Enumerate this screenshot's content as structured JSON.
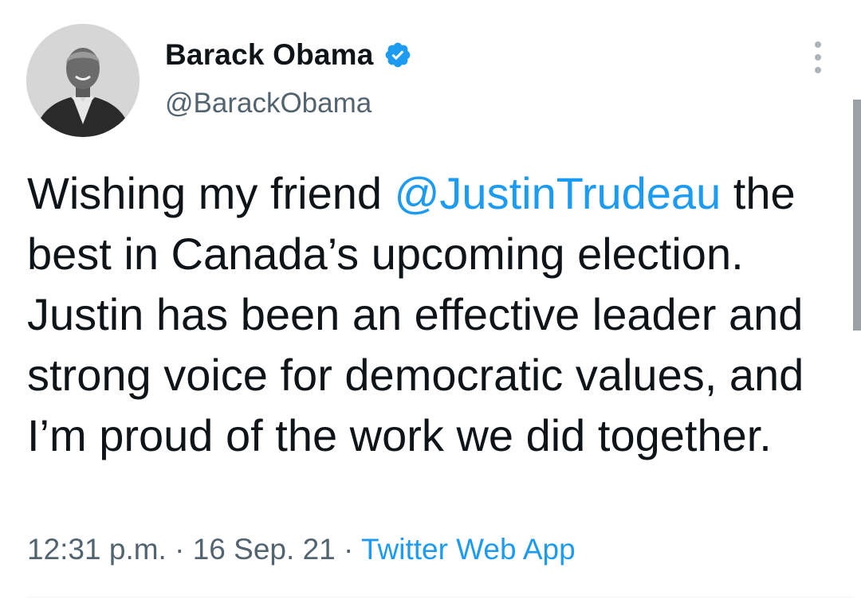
{
  "author": {
    "display_name": "Barack Obama",
    "handle": "@BarackObama",
    "verified_icon": "verified-badge-icon",
    "avatar_icon": "profile-photo"
  },
  "tweet": {
    "text_before": "Wishing my friend ",
    "mention": "@JustinTrudeau",
    "text_after": " the best in Canada’s upcoming election. Justin has been an effective leader and strong voice for democratic values, and I’m proud of the work we did together."
  },
  "meta": {
    "time": "12:31 p.m.",
    "separator": " · ",
    "date": "16 Sep. 21",
    "source": "Twitter Web App"
  },
  "colors": {
    "accent": "#1d9bf0",
    "text": "#0f1419",
    "secondary": "#536471"
  }
}
